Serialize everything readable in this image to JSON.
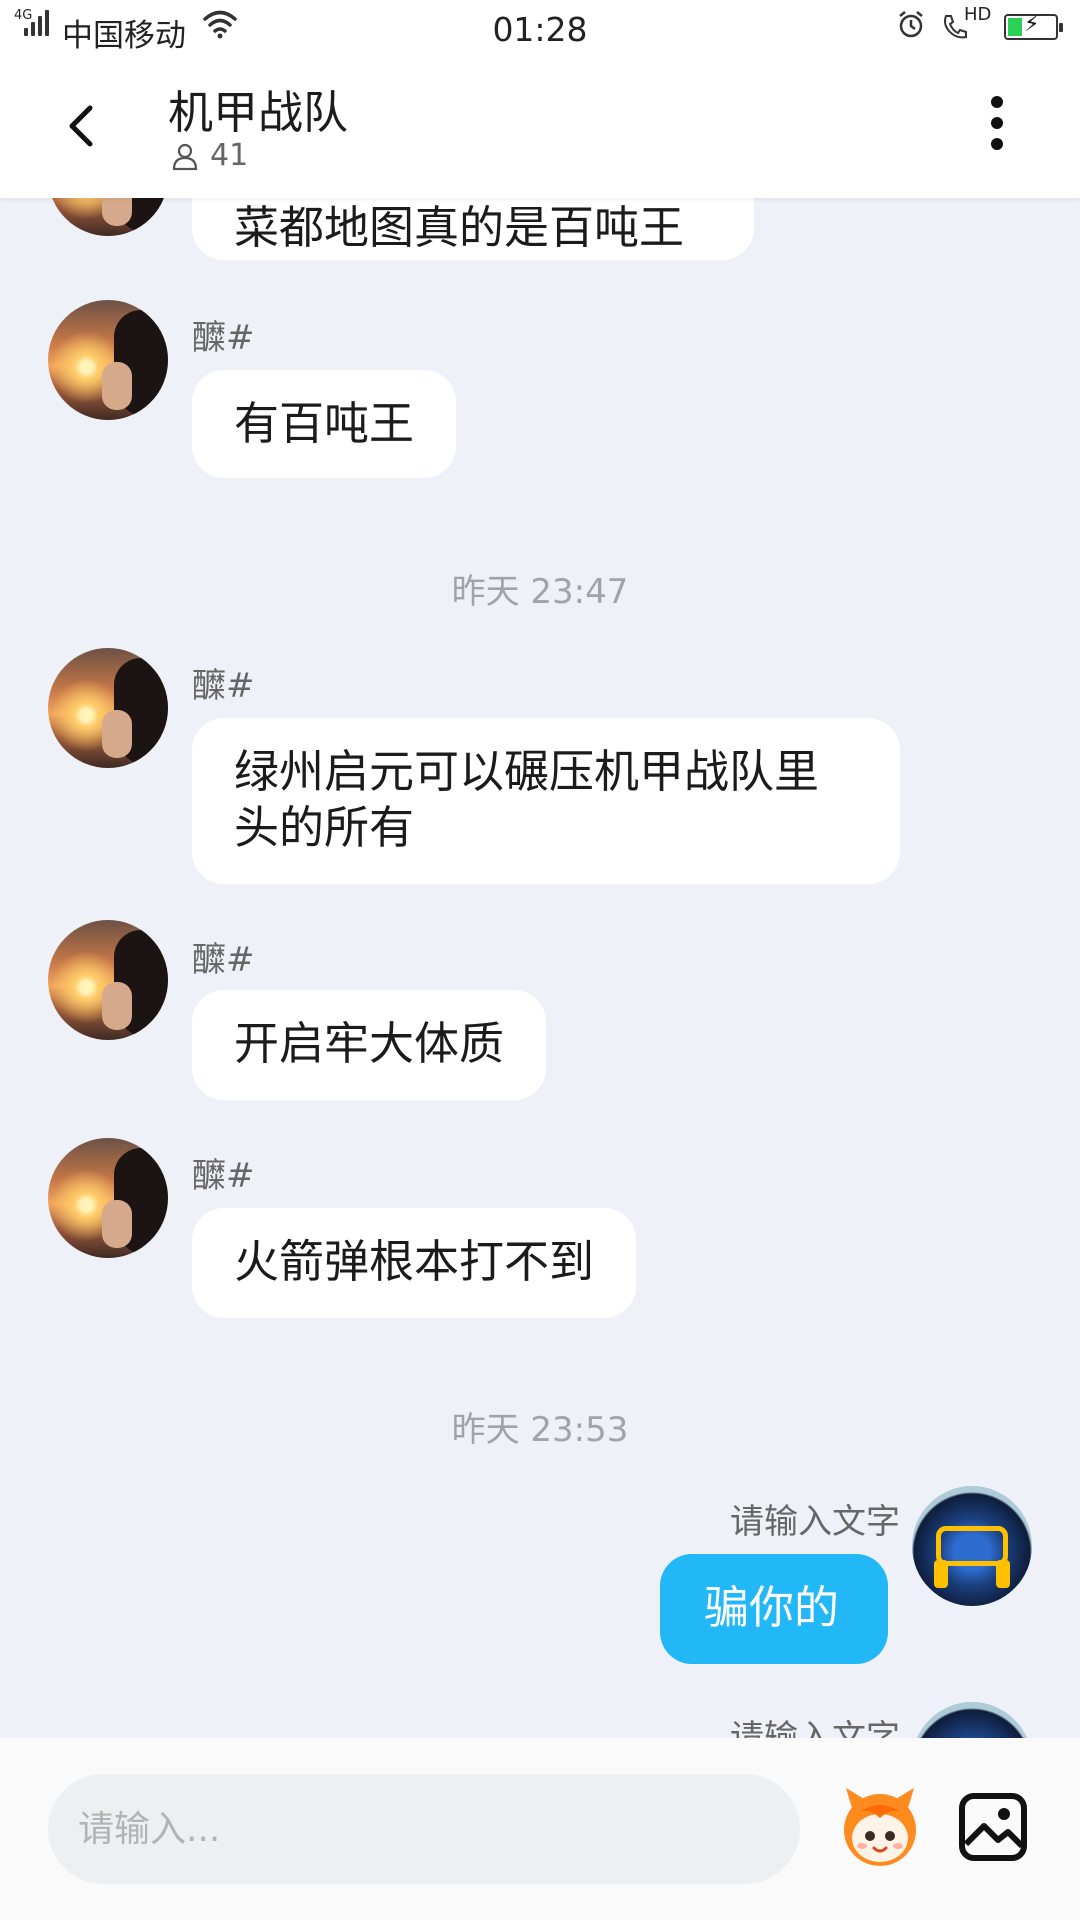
{
  "status_bar": {
    "network": "4G",
    "carrier": "中国移动",
    "time": "01:28",
    "hd": "HD",
    "icons": [
      "signal-icon",
      "wifi-icon",
      "alarm-icon",
      "hd-call-icon",
      "battery-charging-icon"
    ]
  },
  "header": {
    "title": "机甲战队",
    "member_count": "41",
    "icons": [
      "back-arrow-icon",
      "member-icon",
      "more-vertical-icon"
    ]
  },
  "messages": [
    {
      "type": "partial",
      "text": "菜都地图真的是百吨王"
    },
    {
      "type": "received",
      "sender": "醾#",
      "text": "有百吨王"
    },
    {
      "type": "timestamp",
      "text": "昨天 23:47"
    },
    {
      "type": "received",
      "sender": "醾#",
      "text": "绿州启元可以碾压机甲战队里头的所有"
    },
    {
      "type": "received",
      "sender": "醾#",
      "text": "开启牢大体质"
    },
    {
      "type": "received",
      "sender": "醾#",
      "text": "火箭弹根本打不到"
    },
    {
      "type": "timestamp",
      "text": "昨天 23:53"
    },
    {
      "type": "sent",
      "sender": "请输入文字",
      "text": "骗你的"
    },
    {
      "type": "sent-partial",
      "sender": "请输入文字"
    }
  ],
  "input": {
    "placeholder": "请输入...",
    "icons": [
      "emoji-icon",
      "image-icon"
    ]
  },
  "colors": {
    "accent": "#22b7f7",
    "chat_background": "#eef1f7",
    "bubble_received": "#ffffff"
  }
}
